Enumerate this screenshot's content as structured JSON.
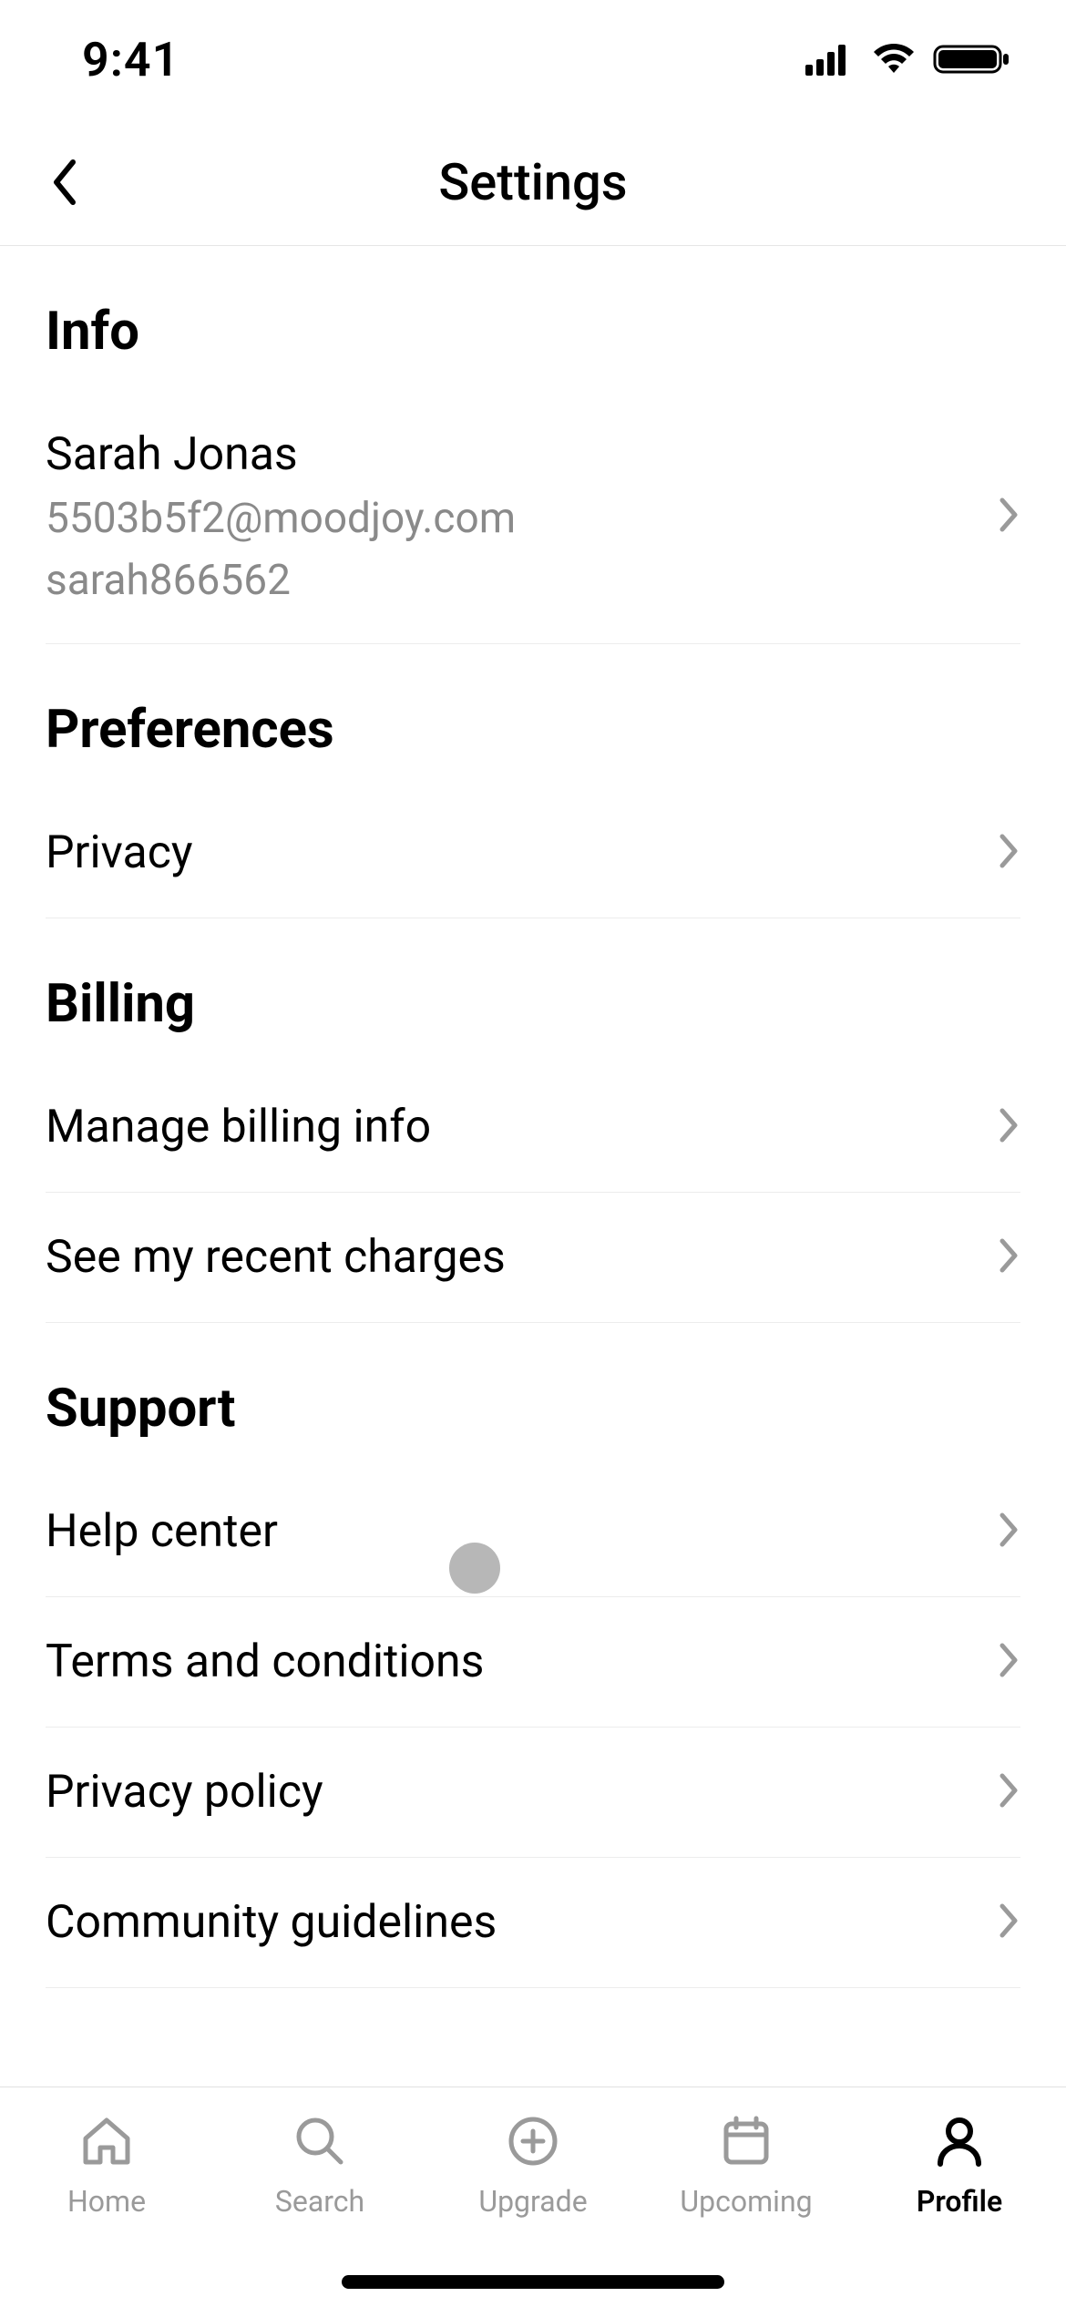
{
  "status": {
    "time": "9:41"
  },
  "header": {
    "title": "Settings"
  },
  "sections": {
    "info": {
      "title": "Info",
      "name": "Sarah Jonas",
      "email": "5503b5f2@moodjoy.com",
      "username": "sarah866562"
    },
    "preferences": {
      "title": "Preferences",
      "privacy": "Privacy"
    },
    "billing": {
      "title": "Billing",
      "manage": "Manage billing info",
      "recent": "See my recent charges"
    },
    "support": {
      "title": "Support",
      "help": "Help center",
      "terms": "Terms and conditions",
      "privacy_policy": "Privacy policy",
      "community": "Community guidelines"
    }
  },
  "tabs": {
    "home": "Home",
    "search": "Search",
    "upgrade": "Upgrade",
    "upcoming": "Upcoming",
    "profile": "Profile"
  }
}
